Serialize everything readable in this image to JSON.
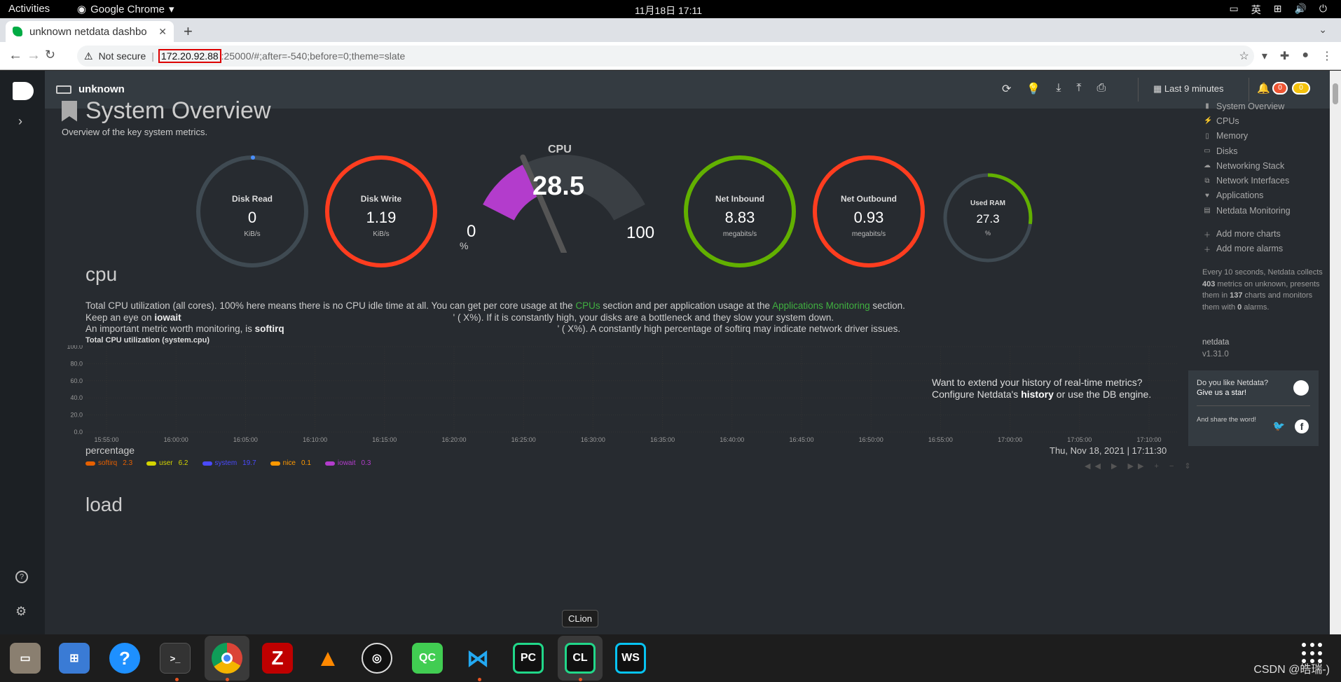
{
  "system": {
    "activities": "Activities",
    "app_name": "Google Chrome",
    "clock": "11月18日  17:11",
    "input_method": "英"
  },
  "browser": {
    "tab_title": "unknown netdata dashbo",
    "security": "Not secure",
    "url_host": "172.20.92.88",
    "url_rest": ":25000/#;after=-540;before=0;theme=slate"
  },
  "header": {
    "hostname": "unknown",
    "time_range": "Last 9 minutes",
    "alarms_critical": "0",
    "alarms_warning": "0"
  },
  "overview": {
    "title": "System Overview",
    "subtitle": "Overview of the key system metrics."
  },
  "gauges": {
    "disk_read": {
      "title": "Disk Read",
      "value": "0",
      "unit": "KiB/s",
      "color": "#3f4a52"
    },
    "disk_write": {
      "title": "Disk Write",
      "value": "1.19",
      "unit": "KiB/s",
      "color": "#ff3d1f"
    },
    "net_in": {
      "title": "Net Inbound",
      "value": "8.83",
      "unit": "megabits/s",
      "color": "#62b000"
    },
    "net_out": {
      "title": "Net Outbound",
      "value": "0.93",
      "unit": "megabits/s",
      "color": "#ff3d1f"
    },
    "ram": {
      "title": "Used RAM",
      "value": "27.3",
      "unit": "%",
      "fraction": 0.273,
      "color": "#62b000"
    },
    "cpu": {
      "title": "CPU",
      "value": "28.5",
      "min": "0",
      "max": "100",
      "unit": "%",
      "fraction": 0.285,
      "color": "#b33ccc"
    }
  },
  "cpu_section": {
    "heading": "cpu",
    "line1_a": "Total CPU utilization (all cores). 100% here means there is no CPU idle time at all. You can get per core usage at the ",
    "line1_link1": "CPUs",
    "line1_b": " section and per application usage at the ",
    "line1_link2": "Applications Monitoring",
    "line1_c": " section.",
    "line2_a": "Keep an eye on ",
    "line2_b": "iowait",
    "line2_c": "' (          X%). If it is constantly high, your disks are a bottleneck and they slow your system down.",
    "line3_a": "An important metric worth monitoring, is ",
    "line3_b": "softirq",
    "line3_c": "' (          X%). A constantly high percentage of softirq may indicate network driver issues."
  },
  "chart_data": {
    "type": "area",
    "title": "Total CPU utilization (system.cpu)",
    "ylabel": "percentage",
    "ylim": [
      0,
      100
    ],
    "y_ticks": [
      "100.0",
      "80.0",
      "60.0",
      "40.0",
      "20.0",
      "0.0"
    ],
    "x_ticks": [
      "15:55:00",
      "16:00:00",
      "16:05:00",
      "16:10:00",
      "16:15:00",
      "16:20:00",
      "16:25:00",
      "16:30:00",
      "16:35:00",
      "16:40:00",
      "16:45:00",
      "16:50:00",
      "16:55:00",
      "17:00:00",
      "17:05:00",
      "17:10:00"
    ],
    "series": [
      {
        "name": "softirq",
        "value": "2.3",
        "color": "#e66000"
      },
      {
        "name": "user",
        "value": "6.2",
        "color": "#d4d400"
      },
      {
        "name": "system",
        "value": "19.7",
        "color": "#4a4aff"
      },
      {
        "name": "nice",
        "value": "0.1",
        "color": "#ff9900"
      },
      {
        "name": "iowait",
        "value": "0.3",
        "color": "#b33ccc"
      }
    ],
    "timestamp": "Thu, Nov 18, 2021 | 17:11:30",
    "promo_line1": "Want to extend your history of real-time metrics?",
    "promo_a": "Configure Netdata's ",
    "promo_b": "history",
    "promo_c": " or use the ",
    "promo_d": "DB engine",
    "promo_e": "."
  },
  "load_section": {
    "heading": "load"
  },
  "right_nav": {
    "items": [
      "System Overview",
      "CPUs",
      "Memory",
      "Disks",
      "Networking Stack",
      "Network Interfaces",
      "Applications",
      "Netdata Monitoring"
    ],
    "add_charts": "Add more charts",
    "add_alarms": "Add more alarms",
    "info_a": "Every 10 seconds, Netdata collects ",
    "info_b": "403",
    "info_c": " metrics on unknown, presents them in ",
    "info_d": "137",
    "info_e": " charts and monitors them with ",
    "info_f": "0",
    "info_g": " alarms.",
    "netdata": "netdata",
    "version": "v1.31.0",
    "star_q": "Do you like Netdata?",
    "star_cta": "Give us a star!",
    "share": "And share the word!"
  },
  "tooltip": "CLion",
  "watermark": "CSDN @皓瑞-)"
}
